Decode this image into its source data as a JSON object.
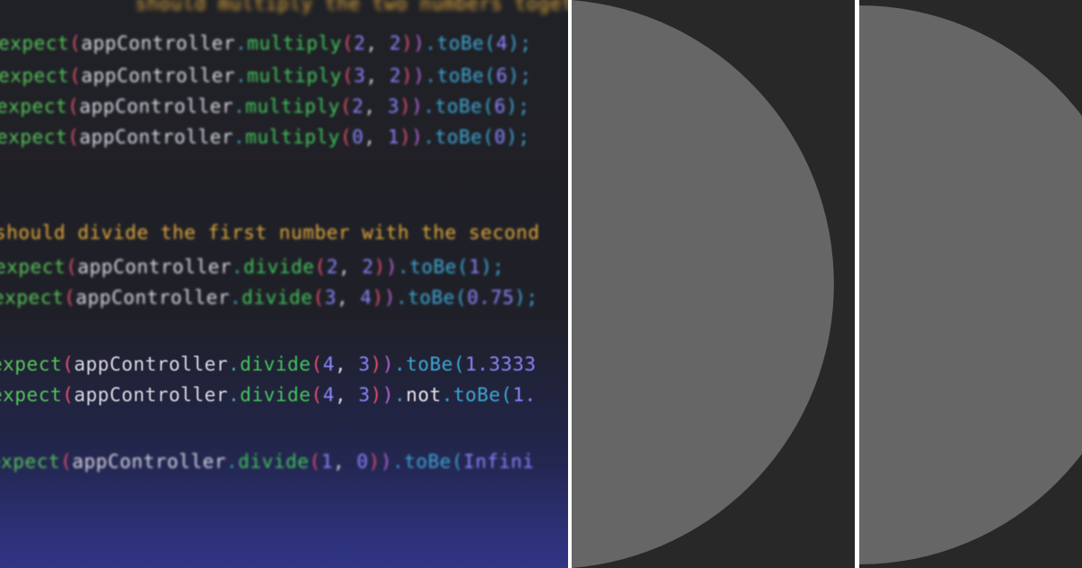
{
  "code_lines": [
    {
      "id": "line-0",
      "parts": [
        {
          "cls": "c-str",
          "t": "should multiply the two numbers together', ()"
        }
      ]
    },
    {
      "id": "line-1",
      "parts": [
        {
          "cls": "c-kw",
          "t": "expect"
        },
        {
          "cls": "c-p1",
          "t": "("
        },
        {
          "cls": "c-obj",
          "t": "appController"
        },
        {
          "cls": "c-dot",
          "t": "."
        },
        {
          "cls": "c-fn",
          "t": "multiply"
        },
        {
          "cls": "c-p1",
          "t": "("
        },
        {
          "cls": "c-num",
          "t": "2"
        },
        {
          "cls": "c-obj",
          "t": ", "
        },
        {
          "cls": "c-num",
          "t": "2"
        },
        {
          "cls": "c-p1",
          "t": ")"
        },
        {
          "cls": "c-p2",
          "t": ")"
        },
        {
          "cls": "c-to",
          "t": ".toBe("
        },
        {
          "cls": "c-num",
          "t": "4"
        },
        {
          "cls": "c-to",
          "t": ");"
        }
      ]
    },
    {
      "id": "line-2",
      "parts": [
        {
          "cls": "c-kw",
          "t": "expect"
        },
        {
          "cls": "c-p1",
          "t": "("
        },
        {
          "cls": "c-obj",
          "t": "appController"
        },
        {
          "cls": "c-dot",
          "t": "."
        },
        {
          "cls": "c-fn",
          "t": "multiply"
        },
        {
          "cls": "c-p1",
          "t": "("
        },
        {
          "cls": "c-num",
          "t": "3"
        },
        {
          "cls": "c-obj",
          "t": ", "
        },
        {
          "cls": "c-num",
          "t": "2"
        },
        {
          "cls": "c-p1",
          "t": ")"
        },
        {
          "cls": "c-p2",
          "t": ")"
        },
        {
          "cls": "c-to",
          "t": ".toBe("
        },
        {
          "cls": "c-num",
          "t": "6"
        },
        {
          "cls": "c-to",
          "t": ");"
        }
      ]
    },
    {
      "id": "line-3",
      "parts": [
        {
          "cls": "c-kw",
          "t": "expect"
        },
        {
          "cls": "c-p1",
          "t": "("
        },
        {
          "cls": "c-obj",
          "t": "appController"
        },
        {
          "cls": "c-dot",
          "t": "."
        },
        {
          "cls": "c-fn",
          "t": "multiply"
        },
        {
          "cls": "c-p1",
          "t": "("
        },
        {
          "cls": "c-num",
          "t": "2"
        },
        {
          "cls": "c-obj",
          "t": ", "
        },
        {
          "cls": "c-num",
          "t": "3"
        },
        {
          "cls": "c-p1",
          "t": ")"
        },
        {
          "cls": "c-p2",
          "t": ")"
        },
        {
          "cls": "c-to",
          "t": ".toBe("
        },
        {
          "cls": "c-num",
          "t": "6"
        },
        {
          "cls": "c-to",
          "t": ");"
        }
      ]
    },
    {
      "id": "line-4",
      "parts": [
        {
          "cls": "c-kw",
          "t": "expect"
        },
        {
          "cls": "c-p1",
          "t": "("
        },
        {
          "cls": "c-obj",
          "t": "appController"
        },
        {
          "cls": "c-dot",
          "t": "."
        },
        {
          "cls": "c-fn",
          "t": "multiply"
        },
        {
          "cls": "c-p1",
          "t": "("
        },
        {
          "cls": "c-num",
          "t": "0"
        },
        {
          "cls": "c-obj",
          "t": ", "
        },
        {
          "cls": "c-num",
          "t": "1"
        },
        {
          "cls": "c-p1",
          "t": ")"
        },
        {
          "cls": "c-p2",
          "t": ")"
        },
        {
          "cls": "c-to",
          "t": ".toBe("
        },
        {
          "cls": "c-num",
          "t": "0"
        },
        {
          "cls": "c-to",
          "t": ");"
        }
      ]
    },
    {
      "id": "line-5",
      "parts": [
        {
          "cls": "c-str",
          "t": "should divide the first number with the second"
        }
      ]
    },
    {
      "id": "line-6",
      "parts": [
        {
          "cls": "c-kw",
          "t": "expect"
        },
        {
          "cls": "c-p1",
          "t": "("
        },
        {
          "cls": "c-obj",
          "t": "appController"
        },
        {
          "cls": "c-dot",
          "t": "."
        },
        {
          "cls": "c-fn",
          "t": "divide"
        },
        {
          "cls": "c-p1",
          "t": "("
        },
        {
          "cls": "c-num",
          "t": "2"
        },
        {
          "cls": "c-obj",
          "t": ", "
        },
        {
          "cls": "c-num",
          "t": "2"
        },
        {
          "cls": "c-p1",
          "t": ")"
        },
        {
          "cls": "c-p2",
          "t": ")"
        },
        {
          "cls": "c-to",
          "t": ".toBe("
        },
        {
          "cls": "c-num",
          "t": "1"
        },
        {
          "cls": "c-to",
          "t": ");"
        }
      ]
    },
    {
      "id": "line-7",
      "parts": [
        {
          "cls": "c-kw",
          "t": "expect"
        },
        {
          "cls": "c-p1",
          "t": "("
        },
        {
          "cls": "c-obj",
          "t": "appController"
        },
        {
          "cls": "c-dot",
          "t": "."
        },
        {
          "cls": "c-fn",
          "t": "divide"
        },
        {
          "cls": "c-p1",
          "t": "("
        },
        {
          "cls": "c-num",
          "t": "3"
        },
        {
          "cls": "c-obj",
          "t": ", "
        },
        {
          "cls": "c-num",
          "t": "4"
        },
        {
          "cls": "c-p1",
          "t": ")"
        },
        {
          "cls": "c-p2",
          "t": ")"
        },
        {
          "cls": "c-to",
          "t": ".toBe("
        },
        {
          "cls": "c-num",
          "t": "0.75"
        },
        {
          "cls": "c-to",
          "t": ");"
        }
      ]
    },
    {
      "id": "line-8",
      "parts": [
        {
          "cls": "c-kw",
          "t": "expect"
        },
        {
          "cls": "c-p1",
          "t": "("
        },
        {
          "cls": "c-obj",
          "t": "appController"
        },
        {
          "cls": "c-dot",
          "t": "."
        },
        {
          "cls": "c-fn",
          "t": "divide"
        },
        {
          "cls": "c-p1",
          "t": "("
        },
        {
          "cls": "c-num",
          "t": "4"
        },
        {
          "cls": "c-obj",
          "t": ", "
        },
        {
          "cls": "c-num",
          "t": "3"
        },
        {
          "cls": "c-p1",
          "t": ")"
        },
        {
          "cls": "c-p2",
          "t": ")"
        },
        {
          "cls": "c-to",
          "t": ".toBe("
        },
        {
          "cls": "c-num",
          "t": "1.3333"
        }
      ]
    },
    {
      "id": "line-9",
      "parts": [
        {
          "cls": "c-kw",
          "t": "expect"
        },
        {
          "cls": "c-p1",
          "t": "("
        },
        {
          "cls": "c-obj",
          "t": "appController"
        },
        {
          "cls": "c-dot",
          "t": "."
        },
        {
          "cls": "c-fn",
          "t": "divide"
        },
        {
          "cls": "c-p1",
          "t": "("
        },
        {
          "cls": "c-num",
          "t": "4"
        },
        {
          "cls": "c-obj",
          "t": ", "
        },
        {
          "cls": "c-num",
          "t": "3"
        },
        {
          "cls": "c-p1",
          "t": ")"
        },
        {
          "cls": "c-p2",
          "t": ")"
        },
        {
          "cls": "c-dot",
          "t": "."
        },
        {
          "cls": "c-not",
          "t": "not"
        },
        {
          "cls": "c-to",
          "t": ".toBe("
        },
        {
          "cls": "c-num",
          "t": "1."
        }
      ]
    },
    {
      "id": "line-10",
      "parts": [
        {
          "cls": "c-kw",
          "t": "expect"
        },
        {
          "cls": "c-p1",
          "t": "("
        },
        {
          "cls": "c-obj",
          "t": "appController"
        },
        {
          "cls": "c-dot",
          "t": "."
        },
        {
          "cls": "c-fn",
          "t": "divide"
        },
        {
          "cls": "c-p1",
          "t": "("
        },
        {
          "cls": "c-num",
          "t": "1"
        },
        {
          "cls": "c-obj",
          "t": ", "
        },
        {
          "cls": "c-num",
          "t": "0"
        },
        {
          "cls": "c-p1",
          "t": ")"
        },
        {
          "cls": "c-p2",
          "t": ")"
        },
        {
          "cls": "c-to",
          "t": ".toBe("
        },
        {
          "cls": "c-num",
          "t": "Infini"
        }
      ]
    }
  ],
  "colors": {
    "panel_background": "#282828",
    "disc_fill": "#666666",
    "divider": "#ffffff"
  }
}
